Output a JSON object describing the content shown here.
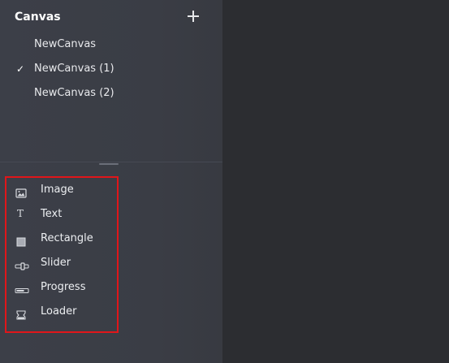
{
  "canvas_section": {
    "title": "Canvas",
    "add_icon": "plus-icon",
    "items": [
      {
        "label": "NewCanvas",
        "selected": false
      },
      {
        "label": "NewCanvas (1)",
        "selected": true
      },
      {
        "label": "NewCanvas (2)",
        "selected": false
      }
    ],
    "check_glyph": "✓"
  },
  "palette": {
    "highlight_color": "#e0161a",
    "items": [
      {
        "label": "Image",
        "icon": "image-icon"
      },
      {
        "label": "Text",
        "icon": "text-icon",
        "glyph": "T"
      },
      {
        "label": "Rectangle",
        "icon": "rectangle-icon"
      },
      {
        "label": "Slider",
        "icon": "slider-icon"
      },
      {
        "label": "Progress",
        "icon": "progress-icon"
      },
      {
        "label": "Loader",
        "icon": "loader-icon"
      }
    ]
  }
}
